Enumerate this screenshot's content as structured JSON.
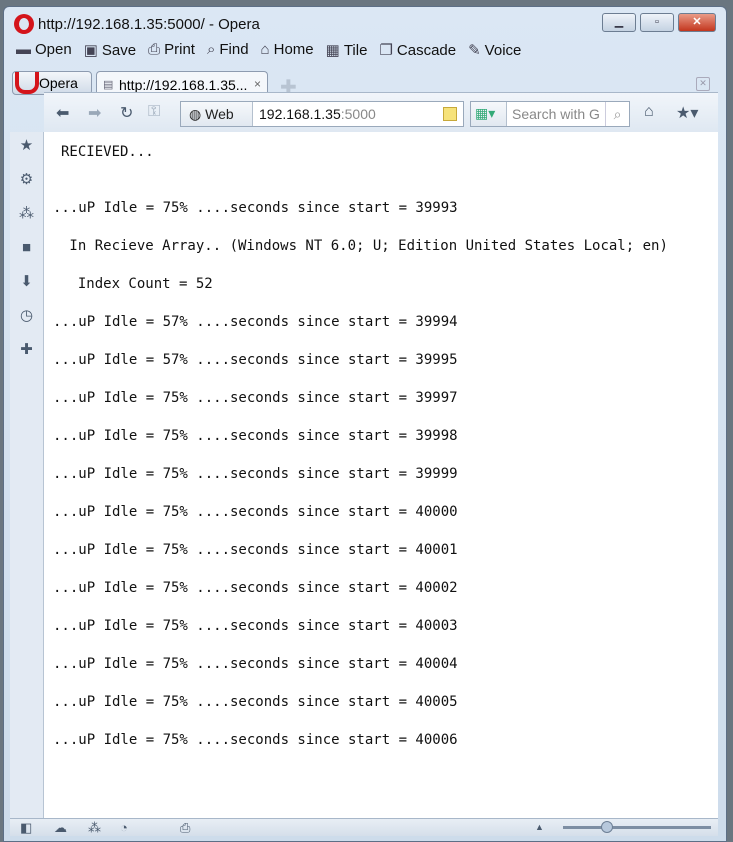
{
  "window": {
    "title": "http://192.168.1.35:5000/ - Opera"
  },
  "menu": [
    {
      "icon": "folder-icon",
      "label": "Open"
    },
    {
      "icon": "save-icon",
      "label": "Save"
    },
    {
      "icon": "print-icon",
      "label": "Print"
    },
    {
      "icon": "search-icon",
      "label": "Find"
    },
    {
      "icon": "home-icon",
      "label": "Home"
    },
    {
      "icon": "tile-icon",
      "label": "Tile"
    },
    {
      "icon": "cascade-icon",
      "label": "Cascade"
    },
    {
      "icon": "microphone-icon",
      "label": "Voice"
    }
  ],
  "tabs": {
    "opera_label": "Opera",
    "active": "http://192.168.1.35...",
    "close": "×"
  },
  "address": {
    "mode": "Web",
    "host": "192.168.1.35",
    "port": ":5000"
  },
  "search": {
    "placeholder": "Search with G"
  },
  "content": {
    "lines": [
      "RECIEVED...",
      "...uP Idle = 75% ....seconds since start = 39993",
      " In Recieve Array.. (Windows NT 6.0; U; Edition United States Local; en)",
      "  Index Count = 52",
      "...uP Idle = 57% ....seconds since start = 39994",
      "...uP Idle = 57% ....seconds since start = 39995",
      "...uP Idle = 75% ....seconds since start = 39997",
      "...uP Idle = 75% ....seconds since start = 39998",
      "...uP Idle = 75% ....seconds since start = 39999",
      "...uP Idle = 75% ....seconds since start = 40000",
      "...uP Idle = 75% ....seconds since start = 40001",
      "...uP Idle = 75% ....seconds since start = 40002",
      "...uP Idle = 75% ....seconds since start = 40003",
      "...uP Idle = 75% ....seconds since start = 40004",
      "...uP Idle = 75% ....seconds since start = 40005",
      "...uP Idle = 75% ....seconds since start = 40006"
    ]
  },
  "status": {
    "zoom_fraction": 0.3
  }
}
